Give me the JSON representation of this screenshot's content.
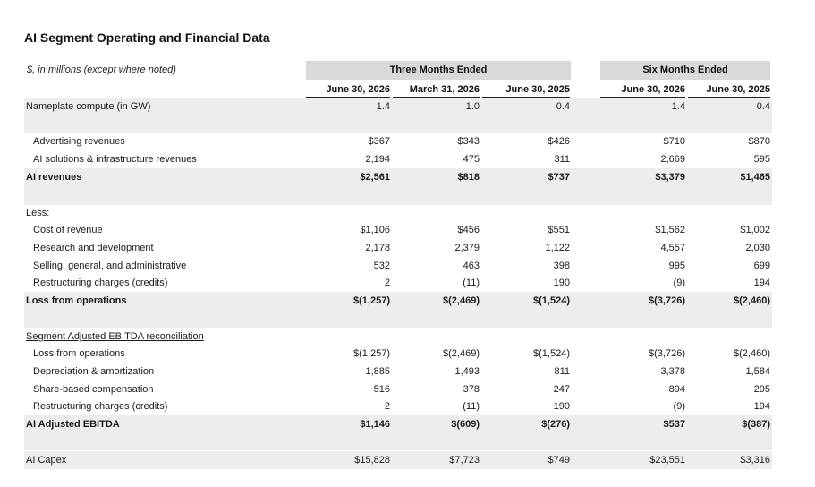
{
  "title": "AI Segment Operating and Financial Data",
  "units_note": "$, in millions (except where noted)",
  "groups": {
    "three_months": "Three Months Ended",
    "six_months": "Six Months Ended"
  },
  "columns": [
    "June 30, 2026",
    "March 31, 2026",
    "June 30, 2025",
    "June 30, 2026",
    "June 30, 2025"
  ],
  "rows": {
    "nameplate": {
      "label": "Nameplate compute (in GW)",
      "values": [
        "1.4",
        "1.0",
        "0.4",
        "1.4",
        "0.4"
      ]
    },
    "advertising": {
      "label": "Advertising revenues",
      "values": [
        "$367",
        "$343",
        "$426",
        "$710",
        "$870"
      ]
    },
    "ai_solutions": {
      "label": "AI solutions & infrastructure revenues",
      "values": [
        "2,194",
        "475",
        "311",
        "2,669",
        "595"
      ]
    },
    "ai_revenues": {
      "label": "AI revenues",
      "values": [
        "$2,561",
        "$818",
        "$737",
        "$3,379",
        "$1,465"
      ]
    },
    "less": {
      "label": "Less:"
    },
    "cost_of_revenue": {
      "label": "Cost of revenue",
      "values": [
        "$1,106",
        "$456",
        "$551",
        "$1,562",
        "$1,002"
      ]
    },
    "rnd": {
      "label": "Research and development",
      "values": [
        "2,178",
        "2,379",
        "1,122",
        "4,557",
        "2,030"
      ]
    },
    "sga": {
      "label": "Selling, general, and administrative",
      "values": [
        "532",
        "463",
        "398",
        "995",
        "699"
      ]
    },
    "restructuring1": {
      "label": "Restructuring charges (credits)",
      "values": [
        "2",
        "(11)",
        "190",
        "(9)",
        "194"
      ]
    },
    "loss_ops": {
      "label": "Loss from operations",
      "values": [
        "$(1,257)",
        "$(2,469)",
        "$(1,524)",
        "$(3,726)",
        "$(2,460)"
      ]
    },
    "recon_header": {
      "label": "Segment Adjusted EBITDA reconciliation"
    },
    "recon_loss": {
      "label": "Loss from operations",
      "values": [
        "$(1,257)",
        "$(2,469)",
        "$(1,524)",
        "$(3,726)",
        "$(2,460)"
      ]
    },
    "dna": {
      "label": "Depreciation & amortization",
      "values": [
        "1,885",
        "1,493",
        "811",
        "3,378",
        "1,584"
      ]
    },
    "sbc": {
      "label": "Share-based compensation",
      "values": [
        "516",
        "378",
        "247",
        "894",
        "295"
      ]
    },
    "restructuring2": {
      "label": "Restructuring charges (credits)",
      "values": [
        "2",
        "(11)",
        "190",
        "(9)",
        "194"
      ]
    },
    "ebitda": {
      "label": "AI Adjusted EBITDA",
      "values": [
        "$1,146",
        "$(609)",
        "$(276)",
        "$537",
        "$(387)"
      ]
    },
    "capex": {
      "label": "AI Capex",
      "values": [
        "$15,828",
        "$7,723",
        "$749",
        "$23,551",
        "$3,316"
      ]
    }
  }
}
